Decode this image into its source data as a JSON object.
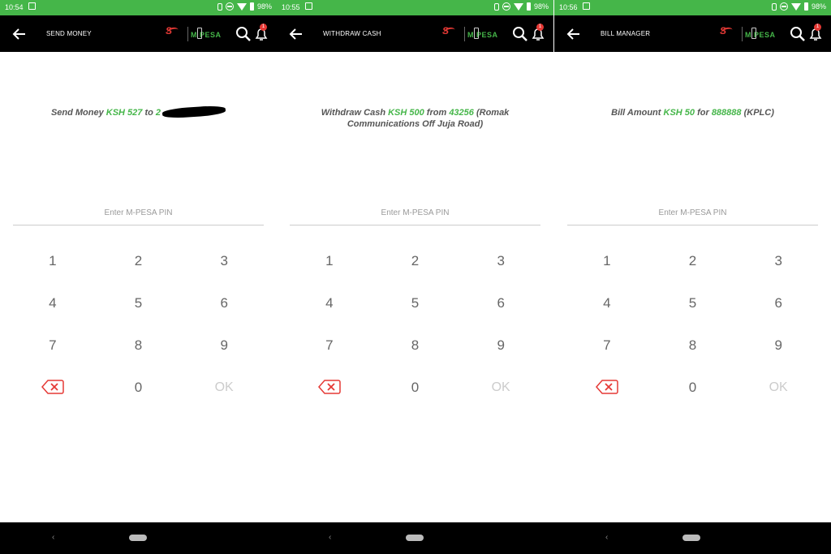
{
  "colors": {
    "accent": "#45b649",
    "alert": "#e53935",
    "bar": "#000000"
  },
  "screens": [
    {
      "status": {
        "time": "10:54",
        "battery": "98%"
      },
      "title": "SEND MONEY",
      "msg": {
        "pre": "Send Money ",
        "amount": "KSH 527",
        "mid": " to ",
        "target": "2",
        "redacted": true,
        "suffix": ""
      },
      "pin_placeholder": "Enter M-PESA PIN",
      "keys": [
        "1",
        "2",
        "3",
        "4",
        "5",
        "6",
        "7",
        "8",
        "9",
        "0",
        "OK"
      ]
    },
    {
      "status": {
        "time": "10:55",
        "battery": "98%"
      },
      "title": "WITHDRAW CASH",
      "msg": {
        "pre": "Withdraw Cash ",
        "amount": "KSH 500",
        "mid": " from ",
        "target": "43256",
        "redacted": false,
        "suffix": " (Romak Communications Off Juja Road)"
      },
      "pin_placeholder": "Enter M-PESA PIN",
      "keys": [
        "1",
        "2",
        "3",
        "4",
        "5",
        "6",
        "7",
        "8",
        "9",
        "0",
        "OK"
      ]
    },
    {
      "status": {
        "time": "10:56",
        "battery": "98%"
      },
      "title": "BILL MANAGER",
      "msg": {
        "pre": "Bill Amount ",
        "amount": "KSH 50",
        "mid": " for ",
        "target": "888888",
        "redacted": false,
        "suffix": " (KPLC)"
      },
      "pin_placeholder": "Enter M-PESA PIN",
      "keys": [
        "1",
        "2",
        "3",
        "4",
        "5",
        "6",
        "7",
        "8",
        "9",
        "0",
        "OK"
      ]
    }
  ],
  "logo": {
    "s": "S",
    "mpesa": "M PESA"
  },
  "badge_count": "1",
  "icons": [
    "arrow-left-icon",
    "search-icon",
    "bell-icon",
    "backspace-icon",
    "nav-back-icon",
    "nav-home-icon",
    "vibrate-icon",
    "dnd-icon",
    "wifi-icon",
    "battery-icon"
  ]
}
